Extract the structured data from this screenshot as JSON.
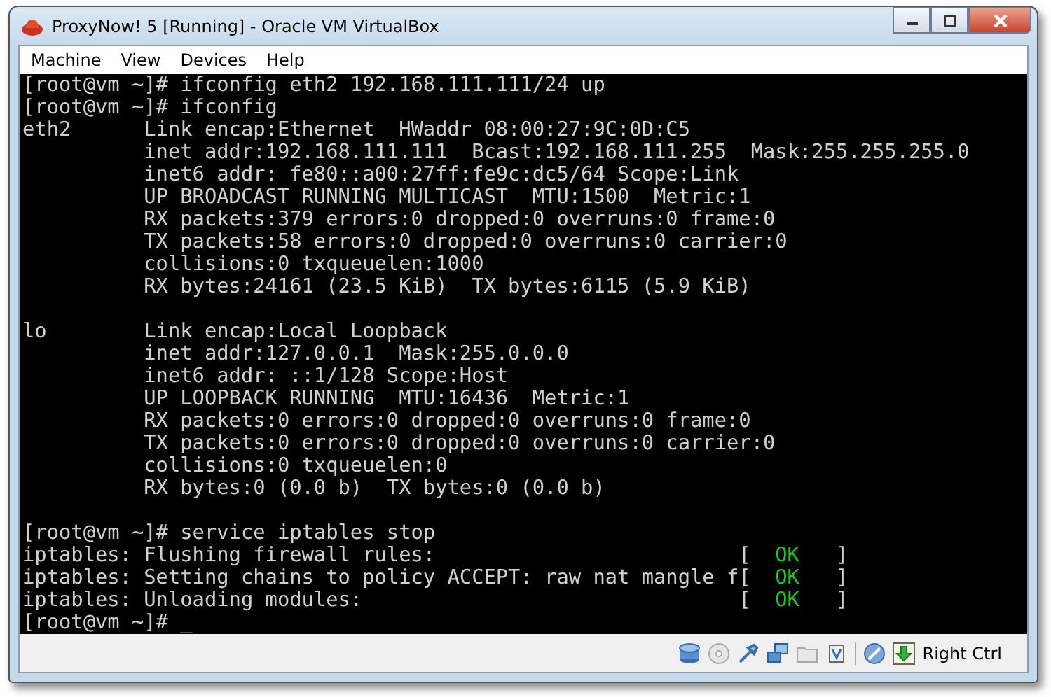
{
  "window": {
    "title": "ProxyNow! 5 [Running] - Oracle VM VirtualBox"
  },
  "menu": [
    "Machine",
    "View",
    "Devices",
    "Help"
  ],
  "terminal": {
    "blocks": [
      [
        {
          "text": "[root@vm ~]# ifconfig eth2 192.168.111.111/24 up"
        },
        {
          "text": "[root@vm ~]# ifconfig"
        },
        {
          "text": "eth2      Link encap:Ethernet  HWaddr 08:00:27:9C:0D:C5"
        },
        {
          "text": "          inet addr:192.168.111.111  Bcast:192.168.111.255  Mask:255.255.255.0"
        },
        {
          "text": "          inet6 addr: fe80::a00:27ff:fe9c:dc5/64 Scope:Link"
        },
        {
          "text": "          UP BROADCAST RUNNING MULTICAST  MTU:1500  Metric:1"
        },
        {
          "text": "          RX packets:379 errors:0 dropped:0 overruns:0 frame:0"
        },
        {
          "text": "          TX packets:58 errors:0 dropped:0 overruns:0 carrier:0"
        },
        {
          "text": "          collisions:0 txqueuelen:1000"
        },
        {
          "text": "          RX bytes:24161 (23.5 KiB)  TX bytes:6115 (5.9 KiB)"
        }
      ],
      [
        {
          "text": "lo        Link encap:Local Loopback"
        },
        {
          "text": "          inet addr:127.0.0.1  Mask:255.0.0.0"
        },
        {
          "text": "          inet6 addr: ::1/128 Scope:Host"
        },
        {
          "text": "          UP LOOPBACK RUNNING  MTU:16436  Metric:1"
        },
        {
          "text": "          RX packets:0 errors:0 dropped:0 overruns:0 frame:0"
        },
        {
          "text": "          TX packets:0 errors:0 dropped:0 overruns:0 carrier:0"
        },
        {
          "text": "          collisions:0 txqueuelen:0"
        },
        {
          "text": "          RX bytes:0 (0.0 b)  TX bytes:0 (0.0 b)"
        }
      ],
      [
        {
          "text": "[root@vm ~]# service iptables stop"
        },
        {
          "text": "iptables: Flushing firewall rules:",
          "status": {
            "open": "[",
            "word": "OK",
            "close": "]"
          }
        },
        {
          "text": "iptables: Setting chains to policy ACCEPT: raw nat mangle f",
          "status": {
            "open": "[",
            "word": "OK",
            "close": "]"
          }
        },
        {
          "text": "iptables: Unloading modules:",
          "status": {
            "open": "[",
            "word": "OK",
            "close": "]"
          }
        },
        {
          "text": "[root@vm ~]# _"
        }
      ]
    ]
  },
  "status_bar": {
    "host_key": "Right Ctrl"
  }
}
